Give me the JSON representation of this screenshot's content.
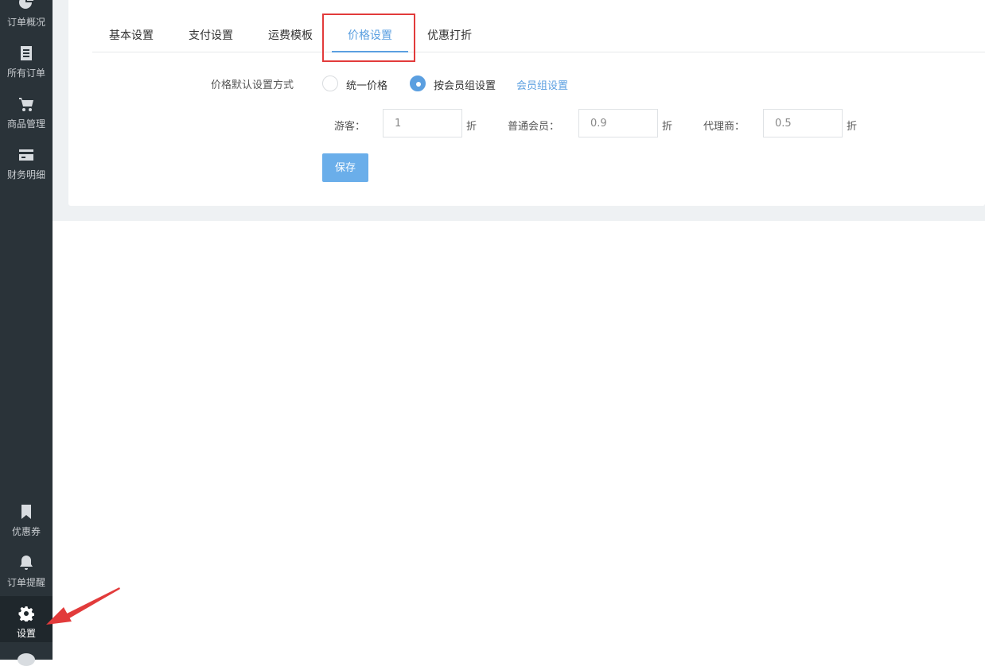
{
  "sidebar": {
    "items": [
      {
        "label": "订单概况",
        "icon": "pie-chart-icon"
      },
      {
        "label": "所有订单",
        "icon": "document-icon"
      },
      {
        "label": "商品管理",
        "icon": "cart-icon"
      },
      {
        "label": "财务明细",
        "icon": "card-icon"
      },
      {
        "label": "优惠券",
        "icon": "bookmark-icon"
      },
      {
        "label": "订单提醒",
        "icon": "bell-icon"
      },
      {
        "label": "设置",
        "icon": "gear-icon",
        "active": true
      }
    ]
  },
  "tabs": [
    {
      "label": "基本设置"
    },
    {
      "label": "支付设置"
    },
    {
      "label": "运费模板"
    },
    {
      "label": "价格设置",
      "active": true
    },
    {
      "label": "优惠打折"
    }
  ],
  "form": {
    "mode_label": "价格默认设置方式",
    "options": [
      {
        "label": "统一价格",
        "checked": false
      },
      {
        "label": "按会员组设置",
        "checked": true
      }
    ],
    "group_link": "会员组设置",
    "fields": [
      {
        "label": "游客：",
        "value": "1",
        "unit": "折"
      },
      {
        "label": "普通会员：",
        "value": "0.9",
        "unit": "折"
      },
      {
        "label": "代理商：",
        "value": "0.5",
        "unit": "折"
      }
    ],
    "save_label": "保存"
  },
  "colors": {
    "sidebar_bg": "#2a3339",
    "accent": "#5b9fe0",
    "highlight": "#e23b3b"
  }
}
